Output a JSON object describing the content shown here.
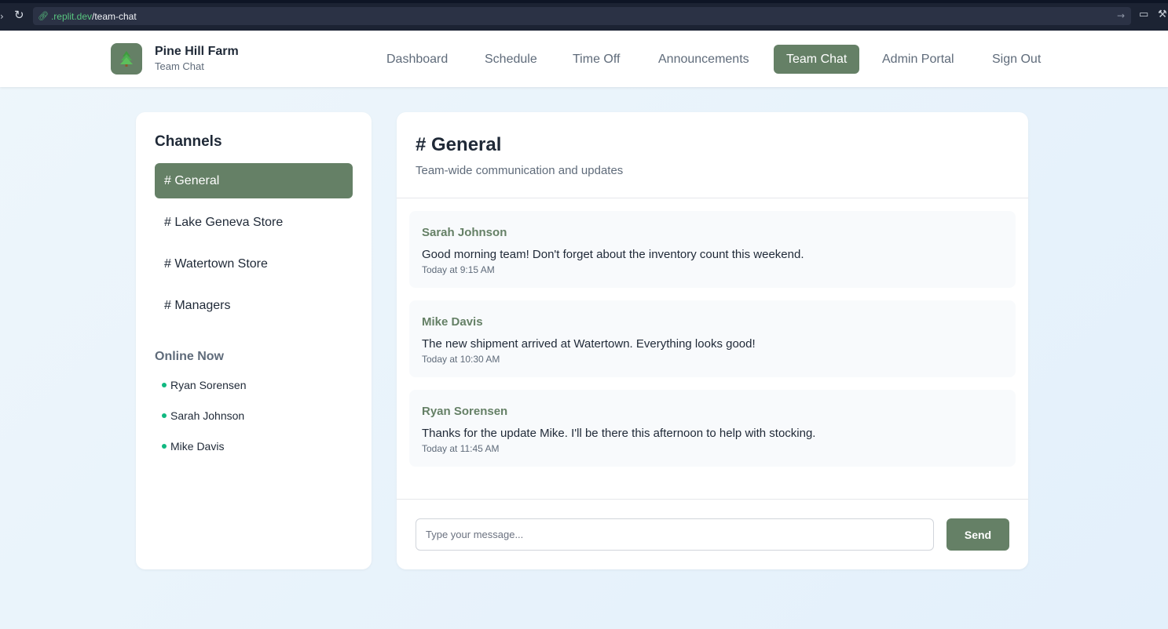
{
  "browser": {
    "back_icon": "chevron-right-icon",
    "reload_icon": "reload-icon",
    "url_icon": "link-icon",
    "url_host": ".replit.dev",
    "url_path": "/team-chat",
    "go_icon": "arrow-right-icon",
    "monitor_icon": "monitor-icon",
    "tool_icon": "wrench-icon"
  },
  "header": {
    "brand_name": "Pine Hill Farm",
    "brand_subtitle": "Team Chat",
    "logo_icon": "pine-tree-icon",
    "nav": [
      {
        "label": "Dashboard"
      },
      {
        "label": "Schedule"
      },
      {
        "label": "Time Off"
      },
      {
        "label": "Announcements"
      },
      {
        "label": "Team Chat",
        "active": true
      },
      {
        "label": "Admin Portal"
      },
      {
        "label": "Sign Out"
      }
    ]
  },
  "sidebar": {
    "title": "Channels",
    "channels": [
      {
        "label": "# General",
        "active": true
      },
      {
        "label": "# Lake Geneva Store"
      },
      {
        "label": "# Watertown Store"
      },
      {
        "label": "# Managers"
      }
    ],
    "online_title": "Online Now",
    "online_users": [
      "Ryan Sorensen",
      "Sarah Johnson",
      "Mike Davis"
    ]
  },
  "chat": {
    "title": "# General",
    "description": "Team-wide communication and updates",
    "messages": [
      {
        "author": "Sarah Johnson",
        "text": "Good morning team! Don't forget about the inventory count this weekend.",
        "time": "Today at 9:15 AM"
      },
      {
        "author": "Mike Davis",
        "text": "The new shipment arrived at Watertown. Everything looks good!",
        "time": "Today at 10:30 AM"
      },
      {
        "author": "Ryan Sorensen",
        "text": "Thanks for the update Mike. I'll be there this afternoon to help with stocking.",
        "time": "Today at 11:45 AM"
      }
    ],
    "input_placeholder": "Type your message...",
    "input_value": "",
    "send_label": "Send"
  },
  "colors": {
    "accent": "#658066",
    "online_dot": "#10b981",
    "browser_bar": "#1c2333"
  }
}
